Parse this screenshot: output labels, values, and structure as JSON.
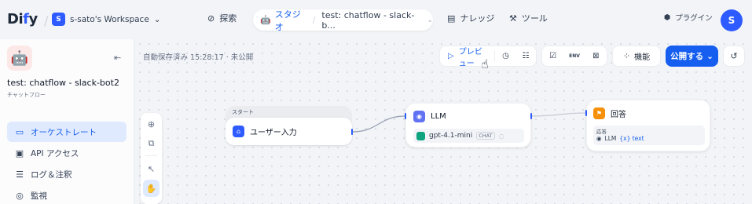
{
  "topbar": {
    "logo_main": "Di",
    "logo_accent": "f",
    "logo_tail": "y",
    "workspace_initial": "S",
    "workspace_name": "s-sato's Workspace",
    "nav_explore": "探索",
    "nav_studio": "スタジオ",
    "nav_app": "test: chatflow - slack-b...",
    "nav_knowledge": "ナレッジ",
    "nav_tools": "ツール",
    "plugins": "プラグイン",
    "avatar_initial": "S"
  },
  "sidebar": {
    "app_name": "test: chatflow - slack-bot2",
    "app_type": "チャットフロー",
    "items": [
      {
        "label": "オーケストレート",
        "icon": "layout-icon",
        "active": true
      },
      {
        "label": "API アクセス",
        "icon": "terminal-icon",
        "active": false
      },
      {
        "label": "ログ＆注釈",
        "icon": "file-list-icon",
        "active": false
      },
      {
        "label": "監視",
        "icon": "monitor-icon",
        "active": false
      }
    ]
  },
  "canvas": {
    "autosave": "自動保存済み 15:28:17 · 未公開",
    "preview_label": "プレビュー",
    "env_label": "ENV",
    "features_label": "機能",
    "publish_label": "公開する"
  },
  "nodes": {
    "start_group_label": "スタート",
    "start_title": "ユーザー入力",
    "llm_title": "LLM",
    "llm_model": "gpt-4.1-mini",
    "llm_mode": "CHAT",
    "answer_title": "回答",
    "answer_field_label": "応答",
    "answer_var_node": "LLM",
    "answer_var_name": "{x} text"
  },
  "colors": {
    "accent": "#155eef",
    "brand": "#2e5bff",
    "active_bg": "#e0eaff"
  }
}
